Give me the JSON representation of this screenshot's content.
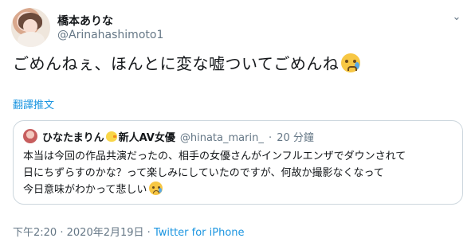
{
  "author": {
    "display_name": "橋本ありな",
    "handle": "@Arinahashimoto1"
  },
  "menu_caret": "⌄",
  "tweet_text": "ごめんねぇ、ほんとに変な嘘ついてごめんね",
  "translate_label": "翻譯推文",
  "quoted": {
    "name_part1": "ひなたまりん",
    "name_part2": "新人AV女優",
    "handle": "@hinata_marin_",
    "separator": "·",
    "time": "20 分鐘",
    "lines": [
      "本当は今回の作品共演だったの、相手の女優さんがインフルエンザでダウンされて",
      "日にちずらすのかな？って楽しみにしていたのですが、何故か撮影なくなって",
      "今日意味がわかって悲しい"
    ]
  },
  "meta": {
    "time": "下午2:20",
    "dot": "·",
    "date": "2020年2月19日",
    "source": "Twitter for iPhone"
  },
  "icons": {
    "avatar": "profile-photo",
    "caret": "chevron-down-icon",
    "emoji": "crying-face-emoji",
    "chick": "hatching-chick-emoji"
  }
}
